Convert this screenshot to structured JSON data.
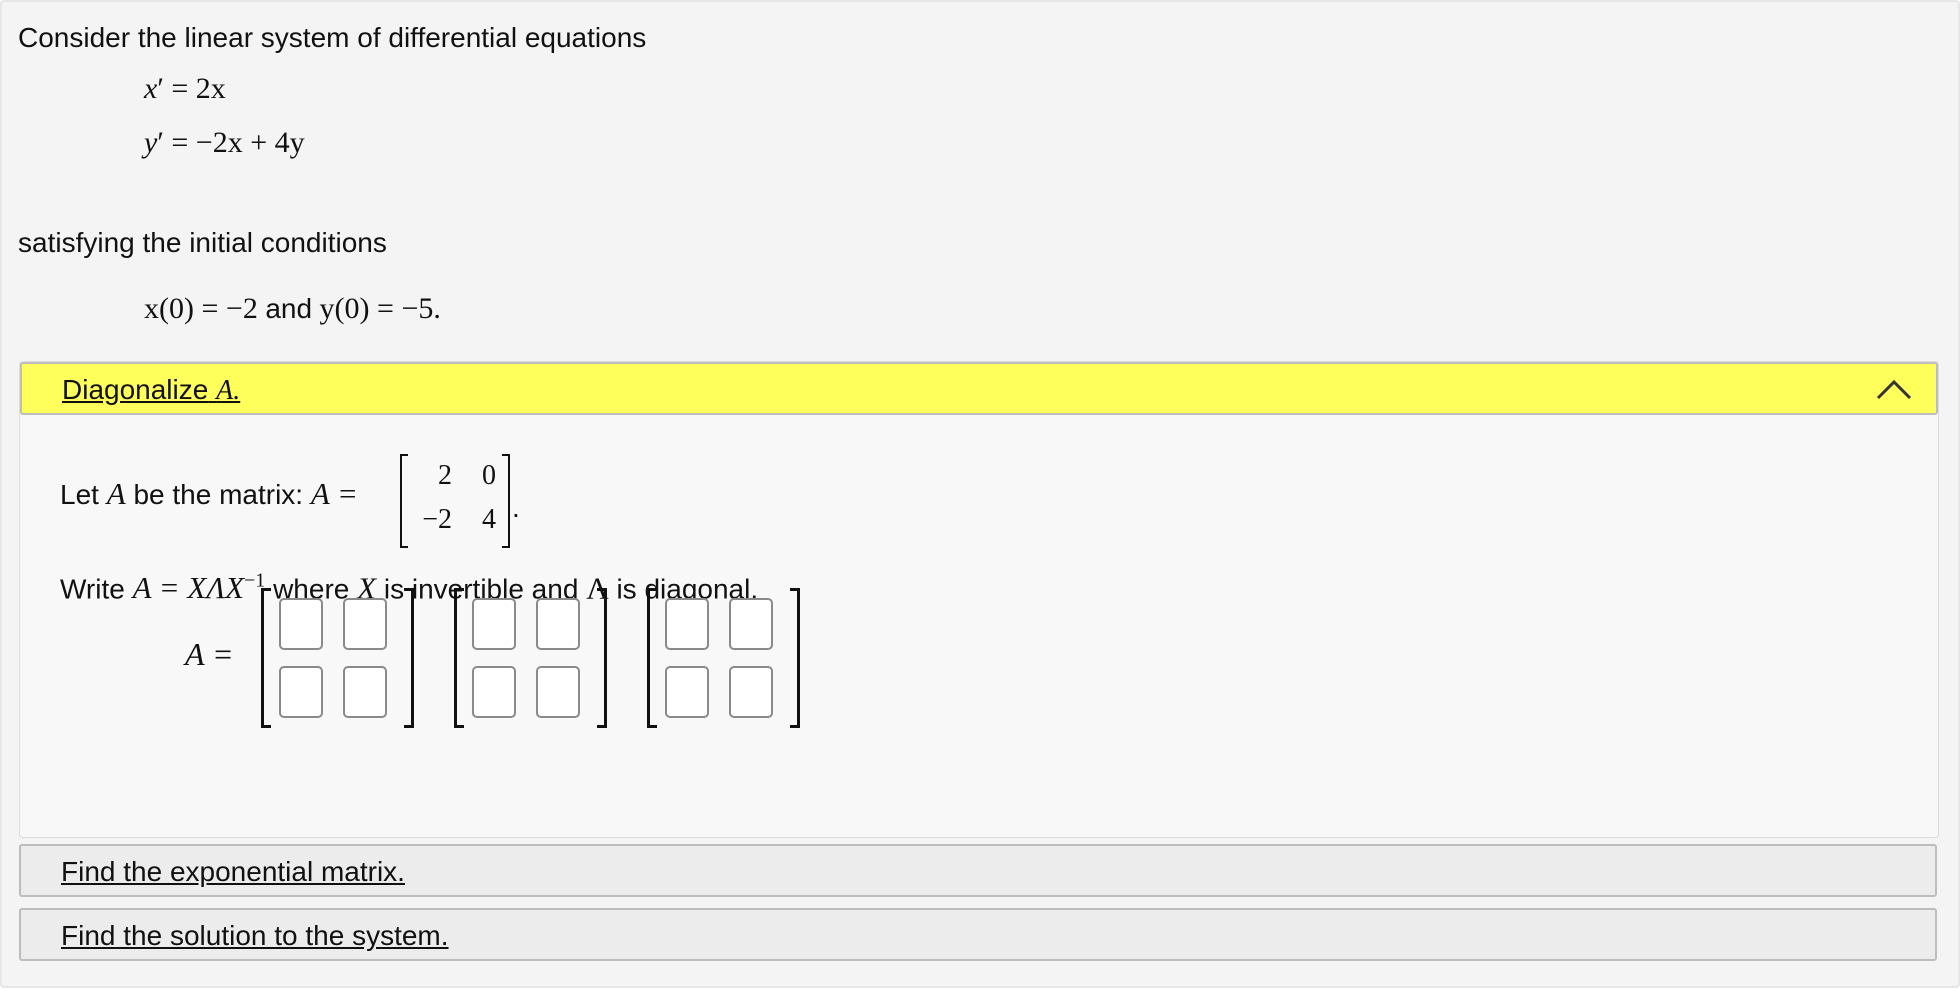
{
  "intro": {
    "line1": "Consider the linear system of differential equations",
    "eq1": {
      "lhs": "x",
      "rhs": "= 2x"
    },
    "eq2": {
      "lhs": "y",
      "rhs": "= −2x + 4y"
    },
    "line2": "satisfying the initial conditions",
    "initial": {
      "x0": "x(0) = −2",
      "and": "and",
      "y0": "y(0) = −5."
    }
  },
  "panel": {
    "title": "Diagonalize",
    "title_var": "A.",
    "let_prefix": "Let",
    "let_var": "A",
    "let_mid": "be the matrix:",
    "let_eq": "A =",
    "matrix": [
      [
        "2",
        "0"
      ],
      [
        "−2",
        "4"
      ]
    ],
    "write_prefix": "Write",
    "write_eq": "A = XΛX",
    "write_exp": "−1",
    "write_where": "where",
    "write_x": "X",
    "write_mid": "is invertible and",
    "write_lambda": "Λ",
    "write_end": "is diagonal.",
    "answer_label": "A ="
  },
  "sections": [
    {
      "label": "Find the exponential matrix."
    },
    {
      "label": "Find the solution to the system."
    }
  ]
}
